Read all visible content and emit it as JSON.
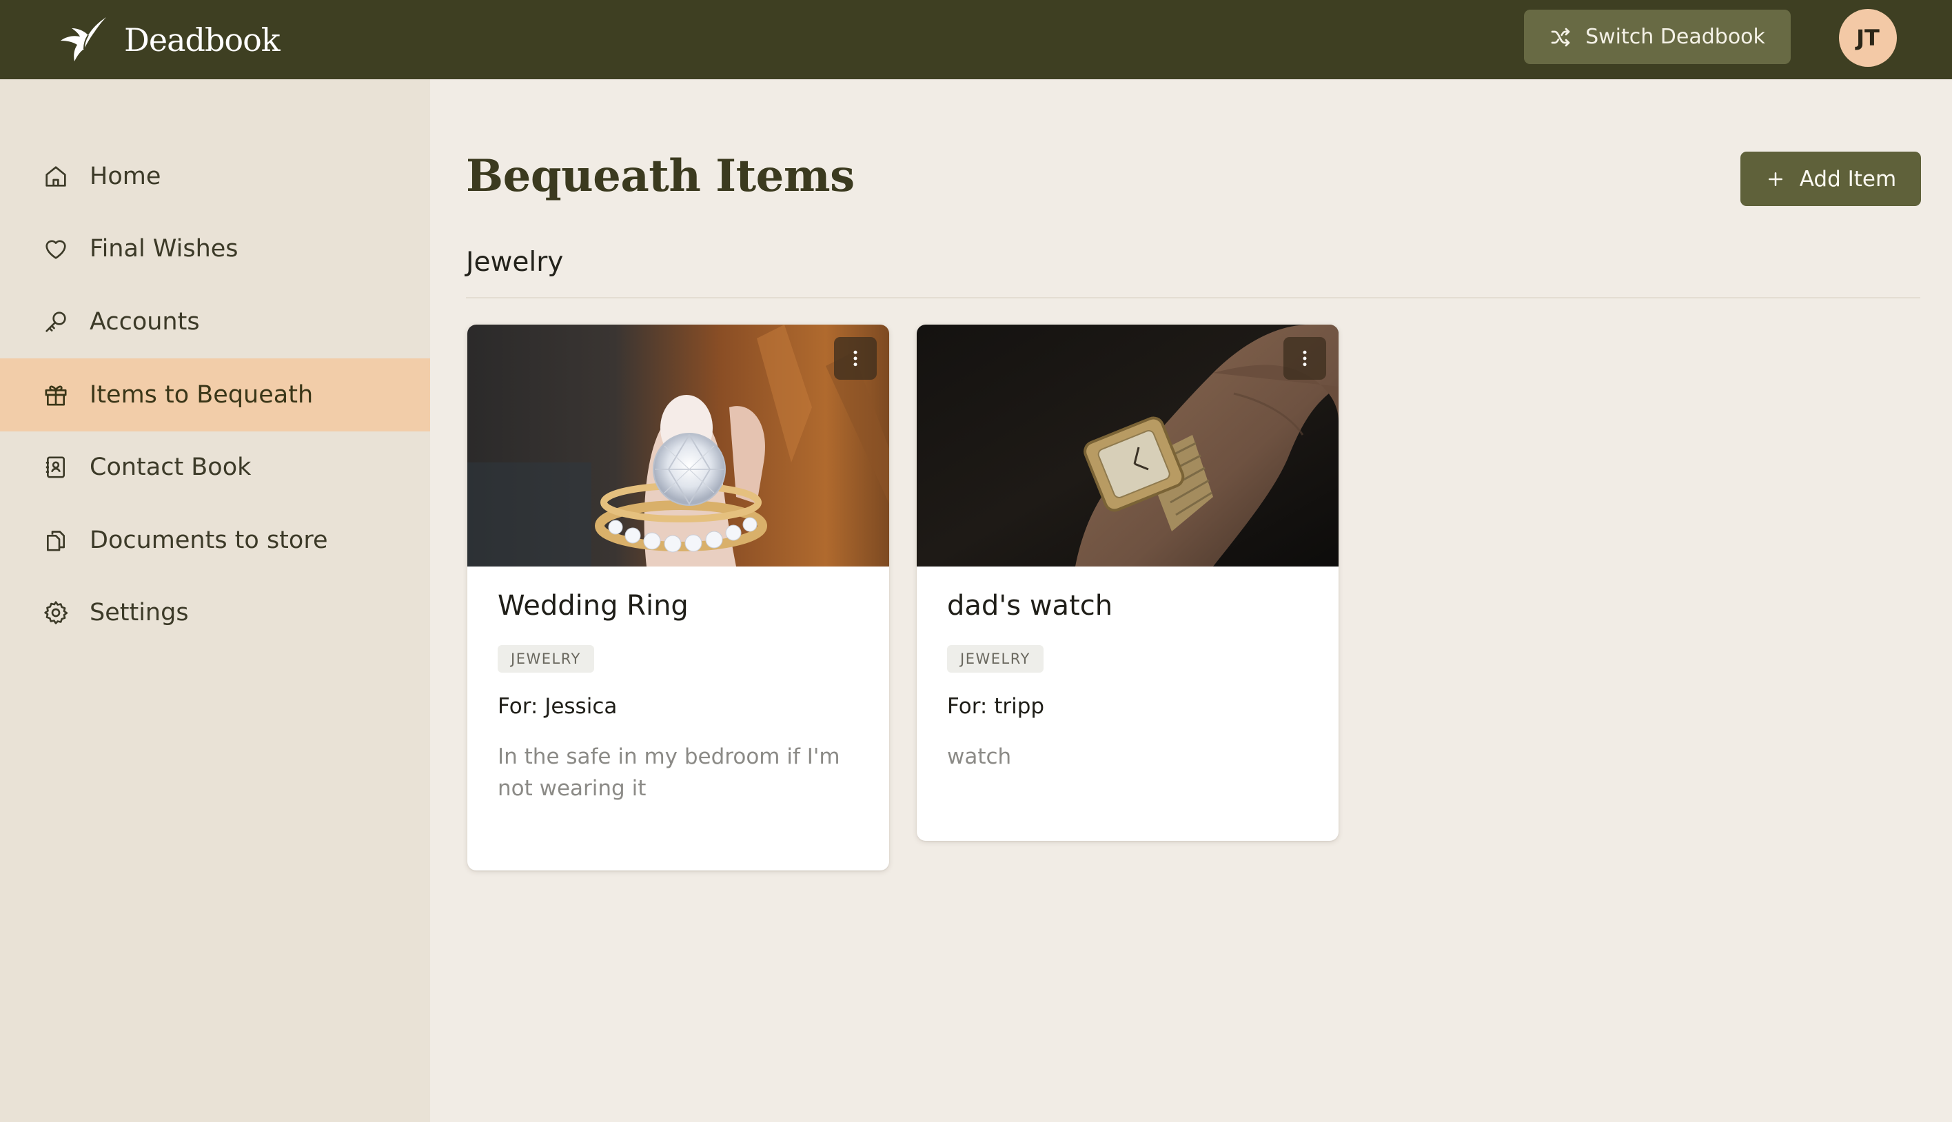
{
  "app": {
    "name": "Deadbook"
  },
  "header": {
    "switch_label": "Switch Deadbook",
    "avatar_initials": "JT"
  },
  "sidebar": {
    "items": [
      {
        "label": "Home",
        "icon": "home-icon",
        "active": false
      },
      {
        "label": "Final Wishes",
        "icon": "heart-icon",
        "active": false
      },
      {
        "label": "Accounts",
        "icon": "key-icon",
        "active": false
      },
      {
        "label": "Items to Bequeath",
        "icon": "gift-icon",
        "active": true
      },
      {
        "label": "Contact Book",
        "icon": "contact-book-icon",
        "active": false
      },
      {
        "label": "Documents to store",
        "icon": "documents-icon",
        "active": false
      },
      {
        "label": "Settings",
        "icon": "gear-icon",
        "active": false
      }
    ]
  },
  "main": {
    "title": "Bequeath Items",
    "add_label": "Add Item",
    "sections": [
      {
        "title": "Jewelry",
        "items": [
          {
            "name": "Wedding Ring",
            "tag": "JEWELRY",
            "recipient": "For: Jessica",
            "note": "In the safe in my bedroom if I'm not wearing it",
            "image": "diamond-ring-photo"
          },
          {
            "name": "dad's watch",
            "tag": "JEWELRY",
            "recipient": "For: tripp",
            "note": "watch",
            "image": "wristwatch-photo"
          }
        ]
      }
    ]
  },
  "colors": {
    "topbar": "#3e3f22",
    "sidebar": "#e9e2d6",
    "active_nav": "#f2cda9",
    "page_bg": "#f1ece5",
    "primary_button": "#5f613a",
    "avatar": "#f3c9a6"
  }
}
